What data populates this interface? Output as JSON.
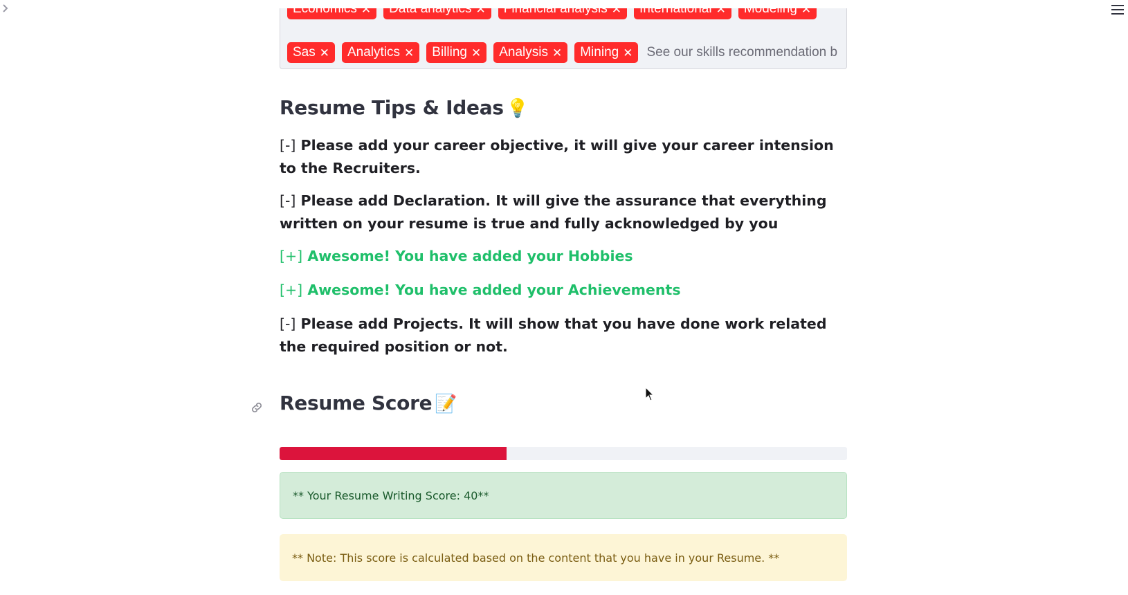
{
  "app": {
    "sidebar_toggle_icon": "chevron-right-icon",
    "menu_icon": "hamburger-menu-icon"
  },
  "skills_multiselect": {
    "tags_top_row": [
      "Economics",
      "Data analytics",
      "Financial analysis",
      "International",
      "Modeling"
    ],
    "tags": [
      "Sas",
      "Analytics",
      "Billing",
      "Analysis",
      "Mining"
    ],
    "remove_glyph": "✕",
    "placeholder": "See our skills recommendation b",
    "tag_color": "#ff2b2b"
  },
  "tips": {
    "heading": "Resume Tips & Ideas",
    "heading_emoji": "💡",
    "items": [
      {
        "bracket": "[-]",
        "text": " Please add your career objective, it will give your career intension to the Recruiters.",
        "status": "missing"
      },
      {
        "bracket": "[-]",
        "text": " Please add Declaration. It will give the assurance that everything written on your resume is true and fully acknowledged by you",
        "status": "missing"
      },
      {
        "bracket": "[+]",
        "text": " Awesome! You have added your Hobbies",
        "status": "added"
      },
      {
        "bracket": "[+]",
        "text": " Awesome! You have added your Achievements",
        "status": "added"
      },
      {
        "bracket": "[-]",
        "text": " Please add Projects. It will show that you have done work related the required position or not.",
        "status": "missing"
      }
    ]
  },
  "score": {
    "heading": "Resume Score",
    "heading_emoji": "📝",
    "progress_percent": 40,
    "progress_color": "#dc143c",
    "success_message": "** Your Resume Writing Score: 40**",
    "note_message": "** Note: This score is calculated based on the content that you have in your Resume. **"
  }
}
